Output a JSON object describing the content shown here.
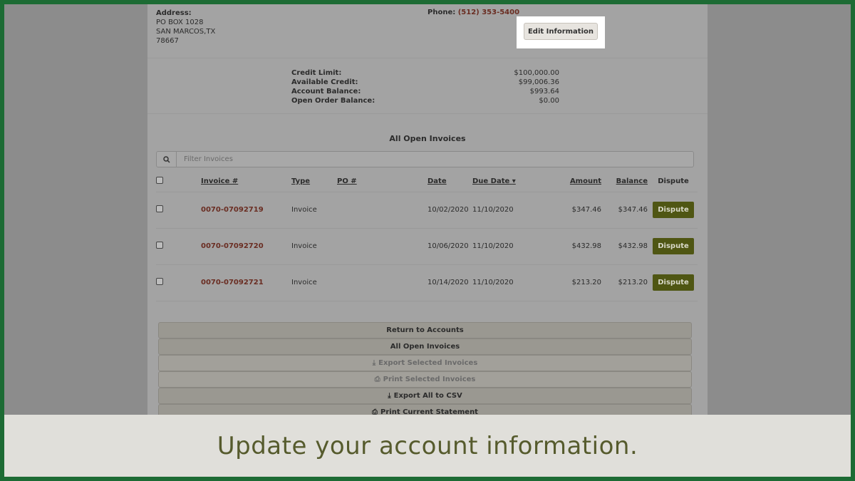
{
  "address": {
    "label": "Address:",
    "line1": "PO BOX 1028",
    "line2": "SAN MARCOS,TX",
    "line3": "78667"
  },
  "phone": {
    "label": "Phone:",
    "value": "(512) 353-5400"
  },
  "edit_button": "Edit Information",
  "credit": [
    {
      "key": "Credit Limit:",
      "value": "$100,000.00"
    },
    {
      "key": "Available Credit:",
      "value": "$99,006.36"
    },
    {
      "key": "Account Balance:",
      "value": "$993.64"
    },
    {
      "key": "Open Order Balance:",
      "value": "$0.00"
    }
  ],
  "invoices_title": "All Open Invoices",
  "filter_placeholder": "Filter Invoices",
  "columns": {
    "invoice": "Invoice #",
    "type": "Type",
    "po": "PO #",
    "date": "Date",
    "due_date": "Due Date",
    "amount": "Amount",
    "balance": "Balance",
    "dispute": "Dispute"
  },
  "rows": [
    {
      "invoice": "0070-07092719",
      "type": "Invoice",
      "po": "",
      "date": "10/02/2020",
      "due": "11/10/2020",
      "amount": "$347.46",
      "balance": "$347.46",
      "dispute": "Dispute"
    },
    {
      "invoice": "0070-07092720",
      "type": "Invoice",
      "po": "",
      "date": "10/06/2020",
      "due": "11/10/2020",
      "amount": "$432.98",
      "balance": "$432.98",
      "dispute": "Dispute"
    },
    {
      "invoice": "0070-07092721",
      "type": "Invoice",
      "po": "",
      "date": "10/14/2020",
      "due": "11/10/2020",
      "amount": "$213.20",
      "balance": "$213.20",
      "dispute": "Dispute"
    }
  ],
  "actions": [
    {
      "label": "Return to Accounts",
      "icon": "",
      "disabled": false
    },
    {
      "label": "All Open Invoices",
      "icon": "",
      "disabled": false
    },
    {
      "label": "Export Selected Invoices",
      "icon": "download-icon",
      "disabled": true
    },
    {
      "label": "Print Selected Invoices",
      "icon": "print-icon",
      "disabled": true
    },
    {
      "label": "Export All to CSV",
      "icon": "download-icon",
      "disabled": false
    },
    {
      "label": "Print Current Statement",
      "icon": "print-icon",
      "disabled": false
    }
  ],
  "caption": "Update your account information."
}
